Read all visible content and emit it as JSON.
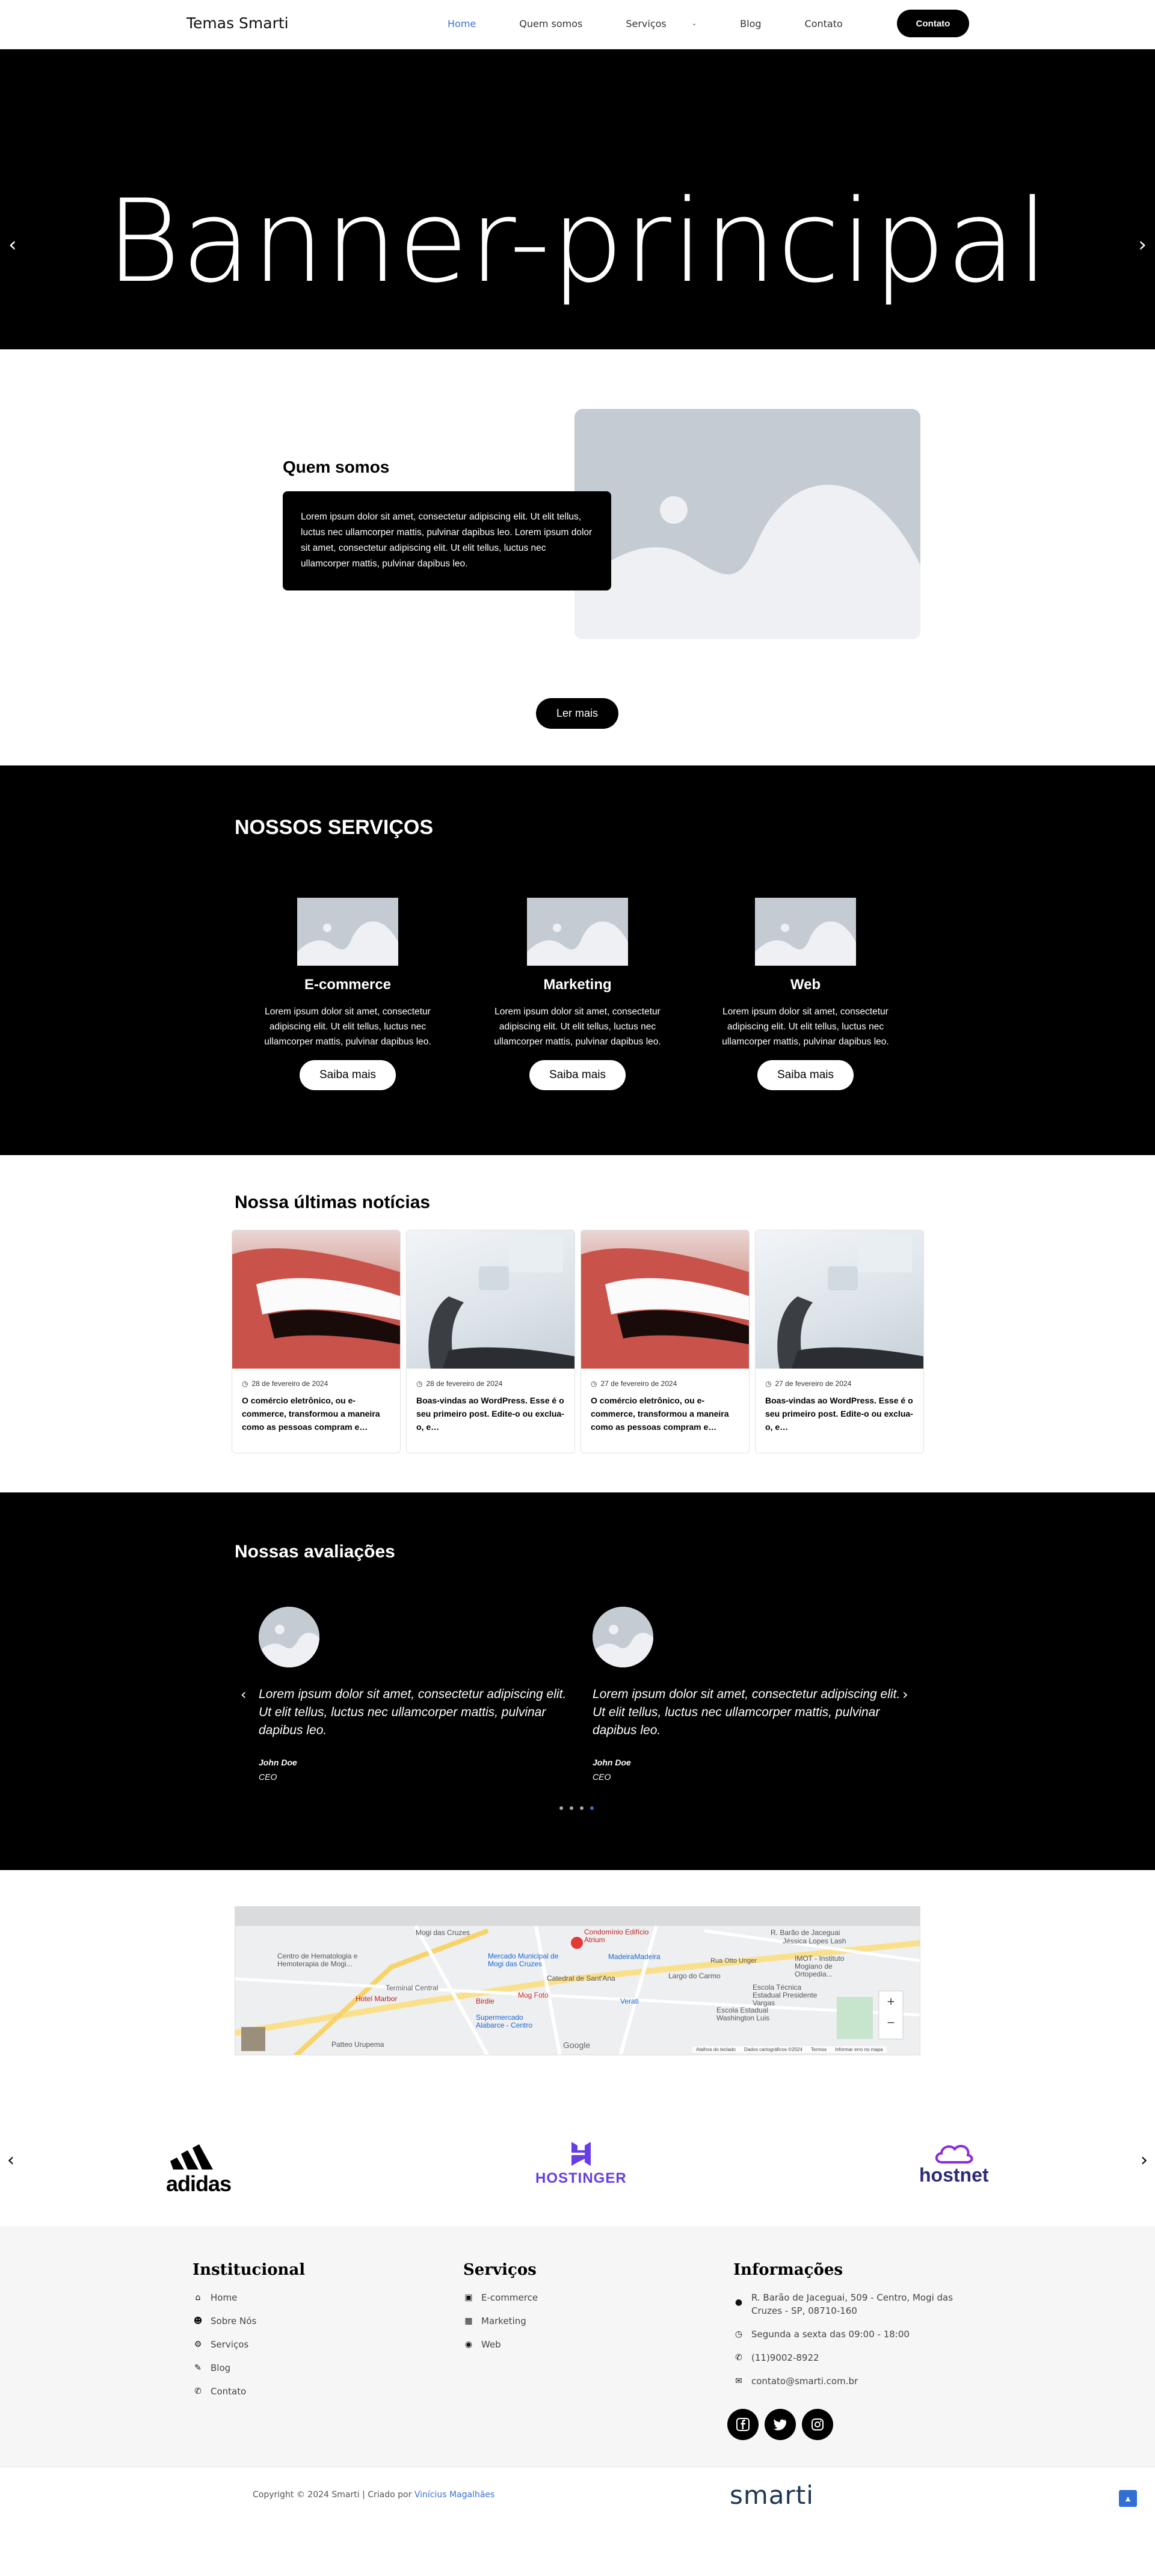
{
  "header": {
    "logo": "Temas Smarti",
    "nav": [
      "Home",
      "Quem somos",
      "Serviços",
      "Blog",
      "Contato"
    ],
    "cta": "Contato"
  },
  "hero": {
    "title": "Banner-principal"
  },
  "about": {
    "title": "Quem somos",
    "text": "Lorem ipsum dolor sit amet, consectetur adipiscing elit. Ut elit tellus, luctus nec ullamcorper mattis, pulvinar dapibus leo. Lorem ipsum dolor sit amet, consectetur adipiscing elit. Ut elit tellus, luctus nec ullamcorper mattis, pulvinar dapibus leo.",
    "button": "Ler mais"
  },
  "services": {
    "title": "NOSSOS SERVIÇOS",
    "items": [
      {
        "name": "E-commerce",
        "text": "Lorem ipsum dolor sit amet, consectetur adipiscing elit. Ut elit tellus, luctus nec ullamcorper mattis, pulvinar dapibus leo.",
        "button": "Saiba mais"
      },
      {
        "name": "Marketing",
        "text": "Lorem ipsum dolor sit amet, consectetur adipiscing elit. Ut elit tellus, luctus nec ullamcorper mattis, pulvinar dapibus leo.",
        "button": "Saiba mais"
      },
      {
        "name": "Web",
        "text": "Lorem ipsum dolor sit amet, consectetur adipiscing elit. Ut elit tellus, luctus nec ullamcorper mattis, pulvinar dapibus leo.",
        "button": "Saiba mais"
      }
    ]
  },
  "news": {
    "title": "Nossa últimas notícias",
    "cards": [
      {
        "date": "28 de fevereiro de 2024",
        "excerpt": "O comércio eletrônico, ou e-commerce, transformou a maneira como as pessoas compram e…",
        "image": "lips"
      },
      {
        "date": "28 de fevereiro de 2024",
        "excerpt": "Boas-vindas ao WordPress. Esse é o seu primeiro post. Edite-o ou exclua-o, e…",
        "image": "dental-chair"
      },
      {
        "date": "27 de fevereiro de 2024",
        "excerpt": "O comércio eletrônico, ou e-commerce, transformou a maneira como as pessoas compram e…",
        "image": "lips"
      },
      {
        "date": "27 de fevereiro de 2024",
        "excerpt": "Boas-vindas ao WordPress. Esse é o seu primeiro post. Edite-o ou exclua-o, e…",
        "image": "dental-chair"
      }
    ]
  },
  "reviews": {
    "title": "Nossas avaliações",
    "items": [
      {
        "quote": "Lorem ipsum dolor sit amet, consectetur adipiscing elit. Ut elit tellus, luctus nec ullamcorper mattis, pulvinar dapibus leo.",
        "name": "John Doe",
        "role": "CEO"
      },
      {
        "quote": "Lorem ipsum dolor sit amet, consectetur adipiscing elit. Ut elit tellus, luctus nec ullamcorper mattis, pulvinar dapibus leo.",
        "name": "John Doe",
        "role": "CEO"
      }
    ],
    "active_dot": 3
  },
  "map": {
    "labels": [
      "Mogi das Cruzes",
      "Condomínio Edifício Atrium",
      "MadeiraMadeira",
      "Mercado Municipal de Mogi das Cruzes",
      "Catedral de Sant'Ana",
      "Centro de Hematologia e Hemoterapia de Mogi...",
      "Terminal Central",
      "Hotel Marbor",
      "Largo do Carmo",
      "IMOT - Instituto Mogiano de Ortopedia...",
      "Escola Técnica Estadual Presidente Vargas",
      "Escola Estadual Washington Luis",
      "Supermercado Alabarce - Centro",
      "Patteo Urupema",
      "Verati",
      "Birdie",
      "Mog Foto",
      "Jéssica Lopes Lash",
      "R. Barão de Jaceguai",
      "Rua Otto Unger",
      "Google"
    ],
    "attribution": [
      "Atalhos do teclado",
      "Dados cartográficos ©2024",
      "Termos",
      "Informar erro no mapa"
    ]
  },
  "logos": {
    "brands": [
      "adidas",
      "HOSTINGER",
      "hostnet"
    ]
  },
  "footer": {
    "col1": {
      "title": "Institucional",
      "items": [
        "Home",
        "Sobre Nós",
        "Serviços",
        "Blog",
        "Contato"
      ]
    },
    "col2": {
      "title": "Serviços",
      "items": [
        "E-commerce",
        "Marketing",
        "Web"
      ]
    },
    "col3": {
      "title": "Informações",
      "address": "R. Barão de Jaceguai, 509 - Centro, Mogi das Cruzes - SP, 08710-160",
      "hours": "Segunda a sexta das 09:00 - 18:00",
      "phone": "(11)9002-8922",
      "email": "contato@smarti.com.br"
    }
  },
  "bottom": {
    "copyright": "Copyright © 2024 Smarti | Criado por",
    "author": "Vinícius Magalhães",
    "brand": "smarti"
  },
  "colors": {
    "accent": "#3a6fd8",
    "dark": "#000000",
    "placeholder": "#c4cbd3"
  }
}
